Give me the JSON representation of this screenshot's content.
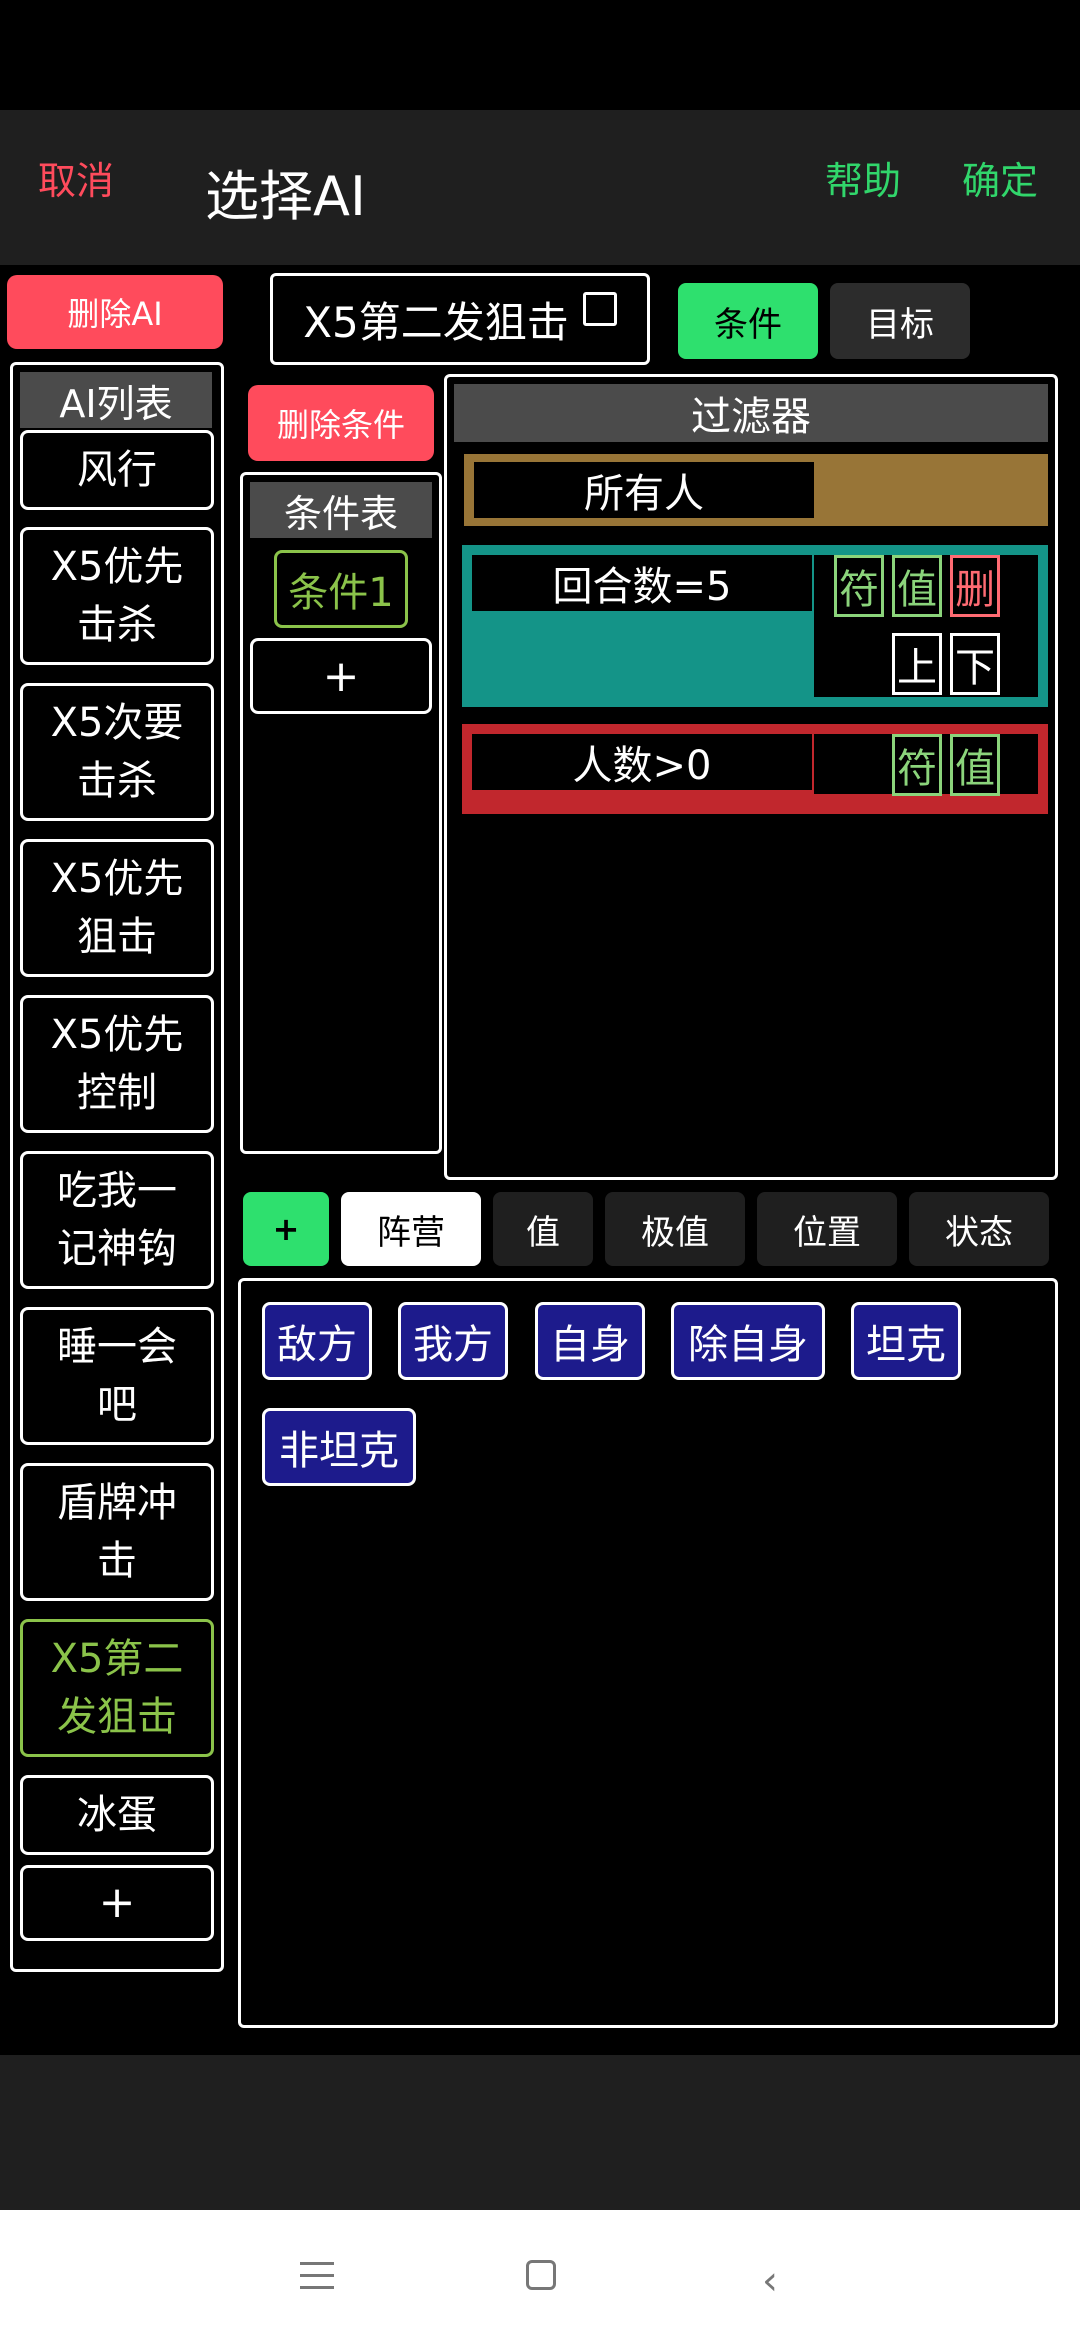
{
  "header": {
    "cancel": "取消",
    "title": "选择AI",
    "help": "帮助",
    "confirm": "确定"
  },
  "ai_list": {
    "delete_button": "删除AI",
    "title": "AI列表",
    "items": [
      {
        "label": "风行"
      },
      {
        "label": "X5优先\n击杀"
      },
      {
        "label": "X5次要\n击杀"
      },
      {
        "label": "X5优先\n狙击"
      },
      {
        "label": "X5优先\n控制"
      },
      {
        "label": "吃我一\n记神钩"
      },
      {
        "label": "睡一会\n吧"
      },
      {
        "label": "盾牌冲\n击"
      },
      {
        "label": "X5第二\n发狙击",
        "active": true
      },
      {
        "label": "冰蛋"
      }
    ],
    "add": "+"
  },
  "ai_name": "X5第二发狙击",
  "mode_tabs": {
    "condition": "条件",
    "target": "目标"
  },
  "condition_list": {
    "delete_button": "删除条件",
    "title": "条件表",
    "items": [
      "条件1"
    ],
    "add": "+"
  },
  "filter": {
    "title": "过滤器",
    "rows": [
      {
        "label": "所有人",
        "color": "#987537"
      },
      {
        "label": "回合数=5",
        "color": "#149488"
      },
      {
        "label": "人数>0",
        "color": "#c1272d"
      }
    ],
    "buttons": {
      "symbol": "符",
      "value": "值",
      "delete": "删",
      "up": "上",
      "down": "下"
    }
  },
  "category_tabs": {
    "add": "+",
    "items": [
      "阵营",
      "值",
      "极值",
      "位置",
      "状态"
    ],
    "selected": "阵营"
  },
  "options": [
    "敌方",
    "我方",
    "自身",
    "除自身",
    "坦克",
    "非坦克"
  ],
  "colors": {
    "accent_green": "#2ee06e",
    "danger_red": "#ff4b5c",
    "active_text": "#8bc34a",
    "option_blue": "#1d1b8c"
  }
}
